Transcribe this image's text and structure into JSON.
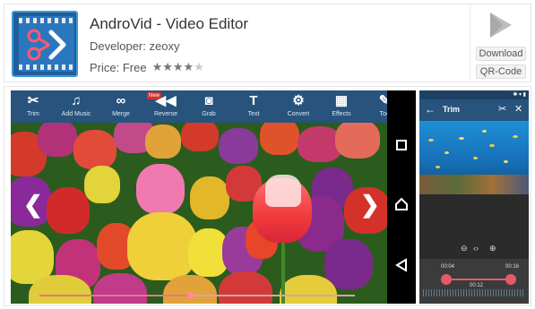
{
  "app": {
    "title": "AndroVid - Video Editor",
    "developer": "Developer: zeoxy",
    "price": "Price: Free",
    "rating_stars_filled": 4,
    "rating_stars_total": 5
  },
  "actions": {
    "download_label": "Download",
    "qr_label": "QR-Code"
  },
  "landscape": {
    "toolbar": [
      {
        "icon": "scissors-icon",
        "label": "Trim"
      },
      {
        "icon": "add-music-icon",
        "label": "Add Music"
      },
      {
        "icon": "link-icon",
        "label": "Merge"
      },
      {
        "icon": "rewind-icon",
        "label": "Reverse"
      },
      {
        "icon": "camera-icon",
        "label": "Grab"
      },
      {
        "icon": "text-icon",
        "label": "Text"
      },
      {
        "icon": "gears-icon",
        "label": "Convert"
      },
      {
        "icon": "film-icon",
        "label": "Effects"
      },
      {
        "icon": "tools-icon",
        "label": "Toc"
      }
    ],
    "new_badge": "New",
    "seek_progress": 0.48
  },
  "portrait": {
    "toolbar_title": "Trim",
    "time_start": "00:04",
    "time_mid": "00:12",
    "time_end": "00:16"
  },
  "colors": {
    "toolbar": "#27537d",
    "accent": "#e45a6a"
  }
}
